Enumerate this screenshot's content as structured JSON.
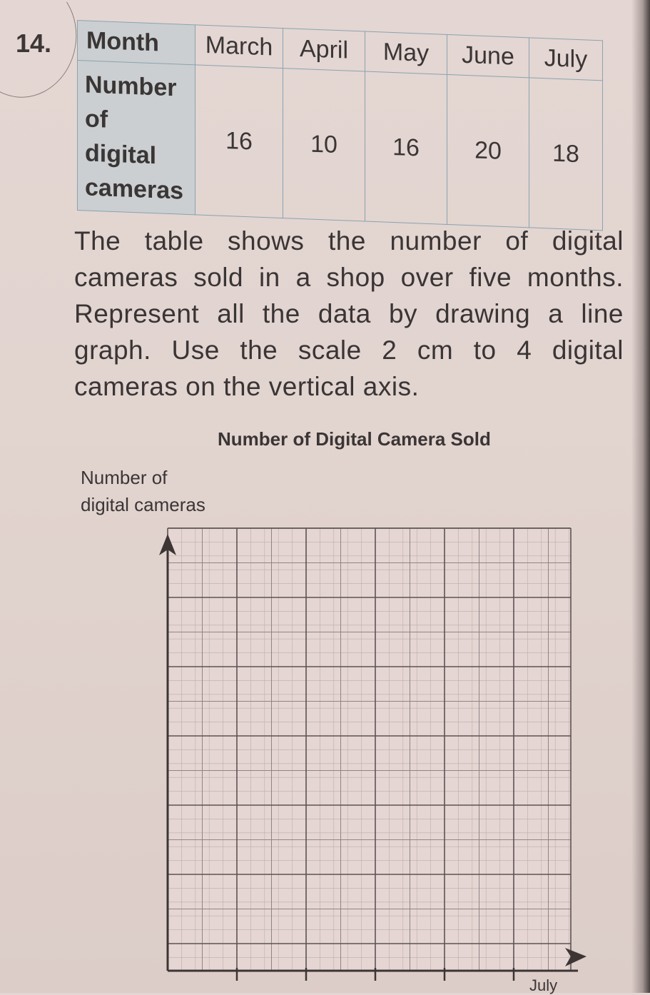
{
  "question": {
    "number": "14."
  },
  "table": {
    "header_label": "Month",
    "row_label_lines": [
      "Number",
      "of",
      "digital",
      "cameras"
    ],
    "months": [
      "March",
      "April",
      "May",
      "June",
      "July"
    ],
    "values": [
      "16",
      "10",
      "16",
      "20",
      "18"
    ]
  },
  "instructions": "The table shows the number of digital cameras sold in a shop over five months. Represent all the data by drawing a line graph. Use the scale 2 cm to 4 digital cameras on the vertical axis.",
  "graph": {
    "title": "Number of Digital Camera Sold",
    "y_axis_label_lines": [
      "Number of",
      "digital cameras"
    ],
    "x_axis_visible_label": "July",
    "state": "blank grid for student to draw on"
  },
  "chart_data": {
    "type": "line",
    "title": "Number of Digital Camera Sold",
    "xlabel": "Month",
    "ylabel": "Number of digital cameras",
    "categories": [
      "March",
      "April",
      "May",
      "June",
      "July"
    ],
    "values": [
      16,
      10,
      16,
      20,
      18
    ],
    "scale_note": "2 cm to 4 digital cameras on the vertical axis",
    "plotted": false,
    "grid": true
  }
}
